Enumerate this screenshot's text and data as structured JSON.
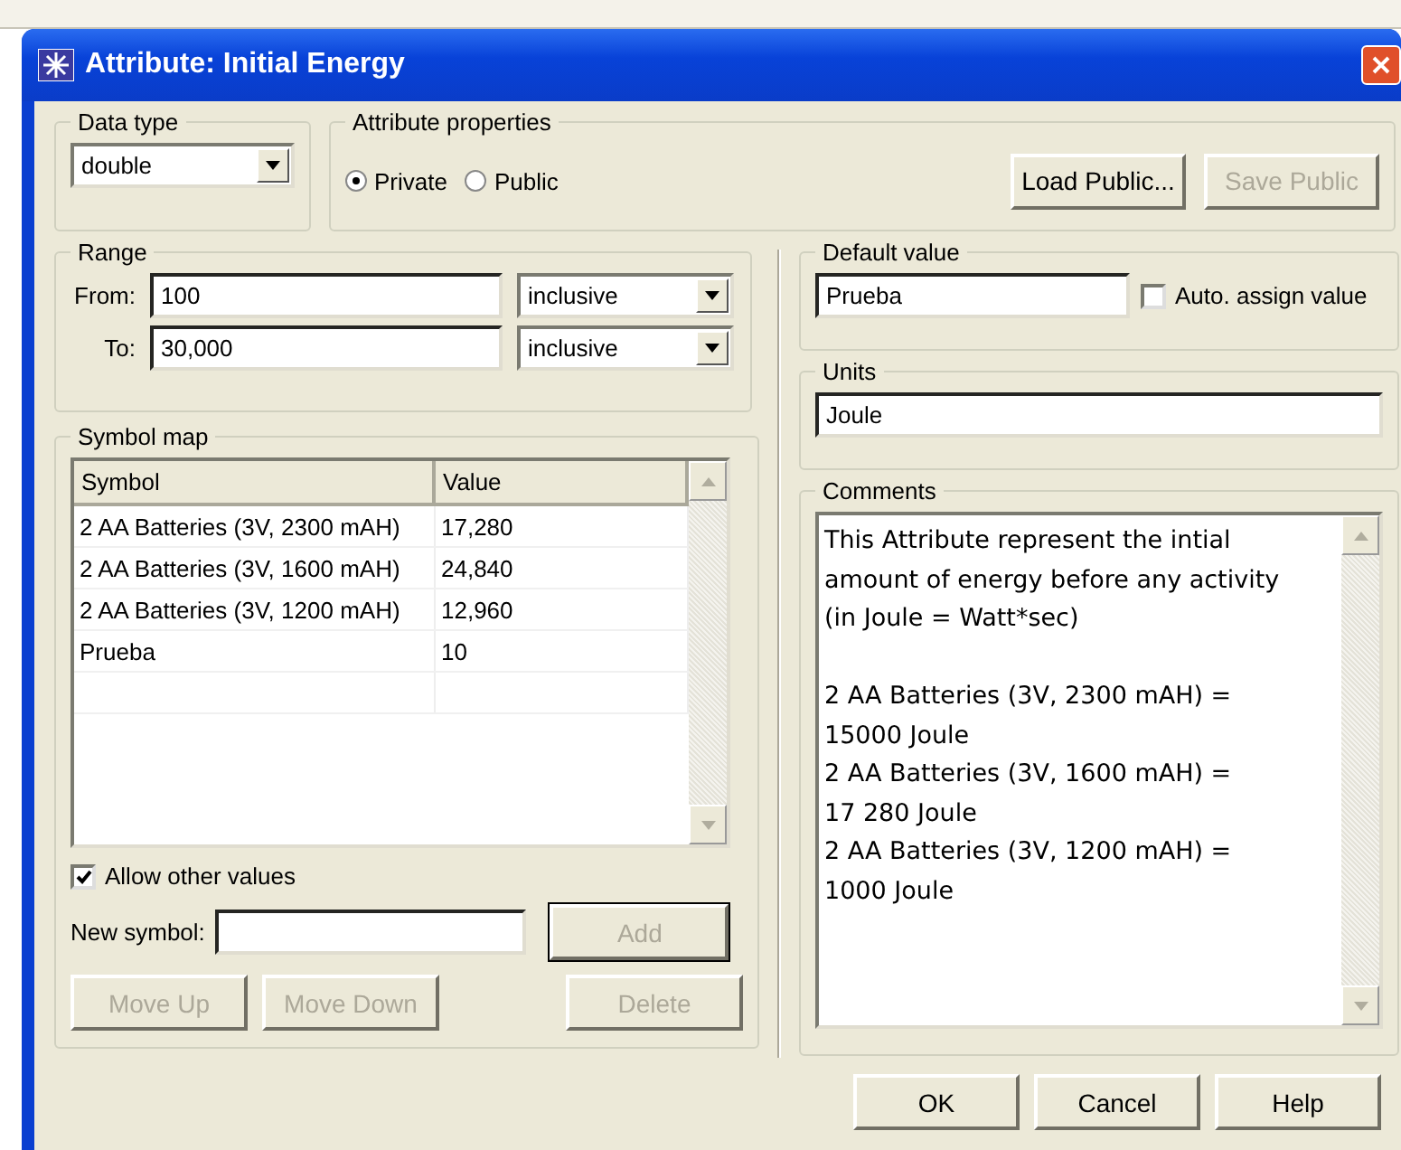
{
  "window": {
    "title": "Attribute: Initial Energy"
  },
  "data_type": {
    "label": "Data type",
    "value": "double"
  },
  "attribute_properties": {
    "label": "Attribute properties",
    "options": [
      {
        "label": "Private",
        "selected": true
      },
      {
        "label": "Public",
        "selected": false
      }
    ],
    "buttons": [
      {
        "label": "Load Public...",
        "disabled": false
      },
      {
        "label": "Save Public",
        "disabled": true
      }
    ]
  },
  "range": {
    "label": "Range",
    "rows": [
      {
        "label": "From:",
        "value": "100",
        "bound": "inclusive"
      },
      {
        "label": "To:",
        "value": "30,000",
        "bound": "inclusive"
      }
    ]
  },
  "symbol_map": {
    "label": "Symbol map",
    "columns": [
      "Symbol",
      "Value"
    ],
    "rows": [
      {
        "symbol": "2 AA Batteries (3V, 2300 mAH)",
        "value": "17,280"
      },
      {
        "symbol": "2 AA Batteries (3V, 1600 mAH)",
        "value": "24,840"
      },
      {
        "symbol": "2 AA Batteries (3V, 1200 mAH)",
        "value": "12,960"
      },
      {
        "symbol": "Prueba",
        "value": "10"
      }
    ],
    "allow_other": {
      "label": "Allow other values",
      "checked": true
    },
    "new_symbol_label": "New symbol:",
    "add": {
      "label": "Add",
      "disabled": true
    },
    "buttons": [
      {
        "label": "Move Up",
        "disabled": true
      },
      {
        "label": "Move Down",
        "disabled": true
      },
      {
        "label": "Delete",
        "disabled": true
      }
    ]
  },
  "default_value": {
    "label": "Default value",
    "value": "Prueba",
    "auto_assign": {
      "label": "Auto. assign value",
      "checked": false
    }
  },
  "units": {
    "label": "Units",
    "value": "Joule"
  },
  "comments": {
    "label": "Comments",
    "lines": [
      "This Attribute represent the intial",
      "amount of energy before any activity",
      "(in Joule = Watt*sec)",
      "2 AA Batteries (3V, 2300 mAH) =",
      "15000 Joule",
      "2 AA Batteries (3V, 1600 mAH) =",
      "17 280 Joule",
      "2 AA Batteries (3V, 1200 mAH) =",
      "1000 Joule"
    ]
  },
  "footer_buttons": [
    "OK",
    "Cancel",
    "Help"
  ]
}
